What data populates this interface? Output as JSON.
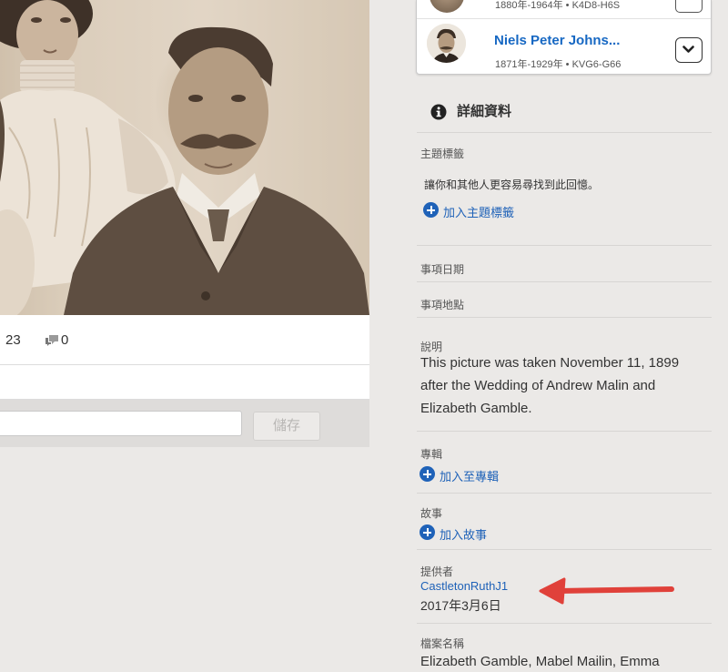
{
  "photo": {
    "alt": ""
  },
  "stats": {
    "count": "23",
    "comments": "0"
  },
  "comment_box": {
    "placeholder": "",
    "save_label": "儲存"
  },
  "persons": [
    {
      "meta": "1880年-1964年 • K4D8-H6S"
    },
    {
      "name": "Niels Peter Johns...",
      "meta": "1871年-1929年 • KVG6-G66"
    }
  ],
  "details": {
    "title": "詳細資料",
    "topic_tags": {
      "label": "主題標籤",
      "hint": "讓你和其他人更容易尋找到此回憶。",
      "add": "加入主題標籤"
    },
    "event_date": {
      "label": "事項日期"
    },
    "event_place": {
      "label": "事項地點"
    },
    "description": {
      "label": "說明",
      "text": "This picture was taken November 11, 1899 after the Wedding of Andrew Malin and Elizabeth Gamble."
    },
    "album": {
      "label": "專輯",
      "add": "加入至專輯"
    },
    "story": {
      "label": "故事",
      "add": "加入故事"
    },
    "contributor": {
      "label": "提供者",
      "name": "CastletonRuthJ1",
      "date": "2017年3月6日"
    },
    "filename": {
      "label": "檔案名稱",
      "value": "Elizabeth Gamble, Mabel Mailin, Emma"
    }
  },
  "colors": {
    "link": "#1f62b8",
    "name": "#1768c3",
    "annotation_arrow": "#e0413a",
    "background": "#ebe9e7"
  }
}
